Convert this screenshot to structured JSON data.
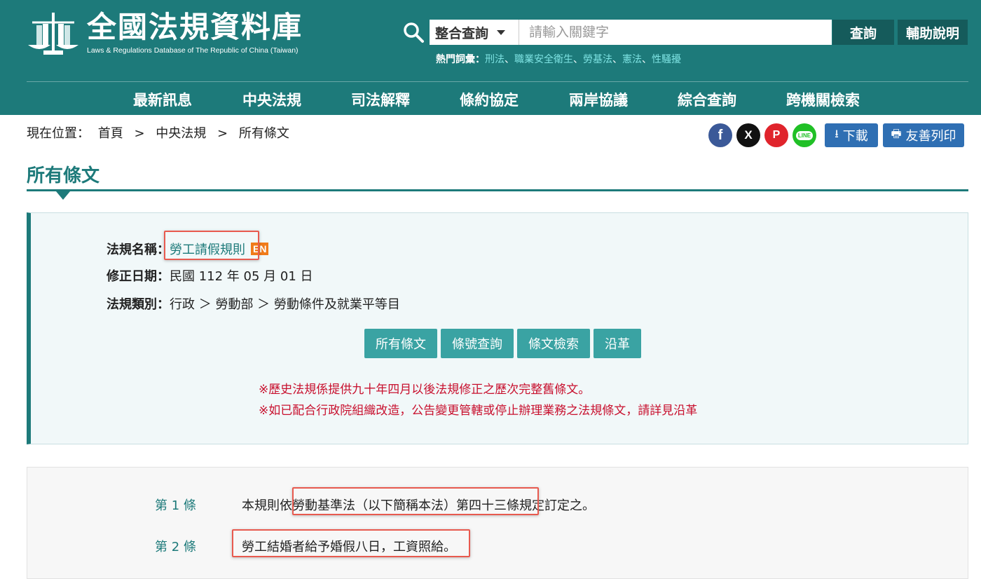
{
  "header": {
    "title": "全國法規資料庫",
    "subtitle": "Laws & Regulations Database of The Republic of China (Taiwan)",
    "search": {
      "scope": "整合查詢",
      "placeholder": "請輸入關鍵字",
      "value": "",
      "query_label": "查詢",
      "help_label": "輔助說明"
    },
    "hot_label": "熱門詞彙：",
    "hot_keywords": [
      "刑法",
      "職業安全衛生",
      "勞基法",
      "憲法",
      "性騷擾"
    ],
    "nav": [
      "最新訊息",
      "中央法規",
      "司法解釋",
      "條約協定",
      "兩岸協議",
      "綜合查詢",
      "跨機關檢索"
    ]
  },
  "breadcrumb": {
    "prefix": "現在位置：",
    "items": [
      "首頁",
      "中央法規",
      "所有條文"
    ],
    "sep": ">"
  },
  "share": {
    "facebook": "f",
    "x": "X",
    "plurk": "P",
    "line": "LINE"
  },
  "tools": {
    "download": "下載",
    "print": "友善列印"
  },
  "page_title": "所有條文",
  "law": {
    "name_label": "法規名稱：",
    "name": "勞工請假規則",
    "en_badge": "EN",
    "date_label": "修正日期：",
    "date": "民國 112 年 05 月 01 日",
    "category_label": "法規類別：",
    "category": "行政 ＞ 勞動部 ＞ 勞動條件及就業平等目"
  },
  "tabs": [
    "所有條文",
    "條號查詢",
    "條文檢索",
    "沿革"
  ],
  "notes": [
    "※歷史法規係提供九十年四月以後法規修正之歷次完整舊條文。",
    "※如已配合行政院組織改造，公告變更管轄或停止辦理業務之法規條文，請詳見沿革"
  ],
  "articles": [
    {
      "no": "第 1 條",
      "text": "本規則依勞動基準法（以下簡稱本法）第四十三條規定訂定之。"
    },
    {
      "no": "第 2 條",
      "text": "勞工結婚者給予婚假八日，工資照給。"
    }
  ],
  "colors": {
    "brand": "#1d7a7a",
    "tab": "#3aa3a3",
    "notice": "#c8102e",
    "highlight": "#e85a4f",
    "tool_button": "#2f6fb3"
  }
}
